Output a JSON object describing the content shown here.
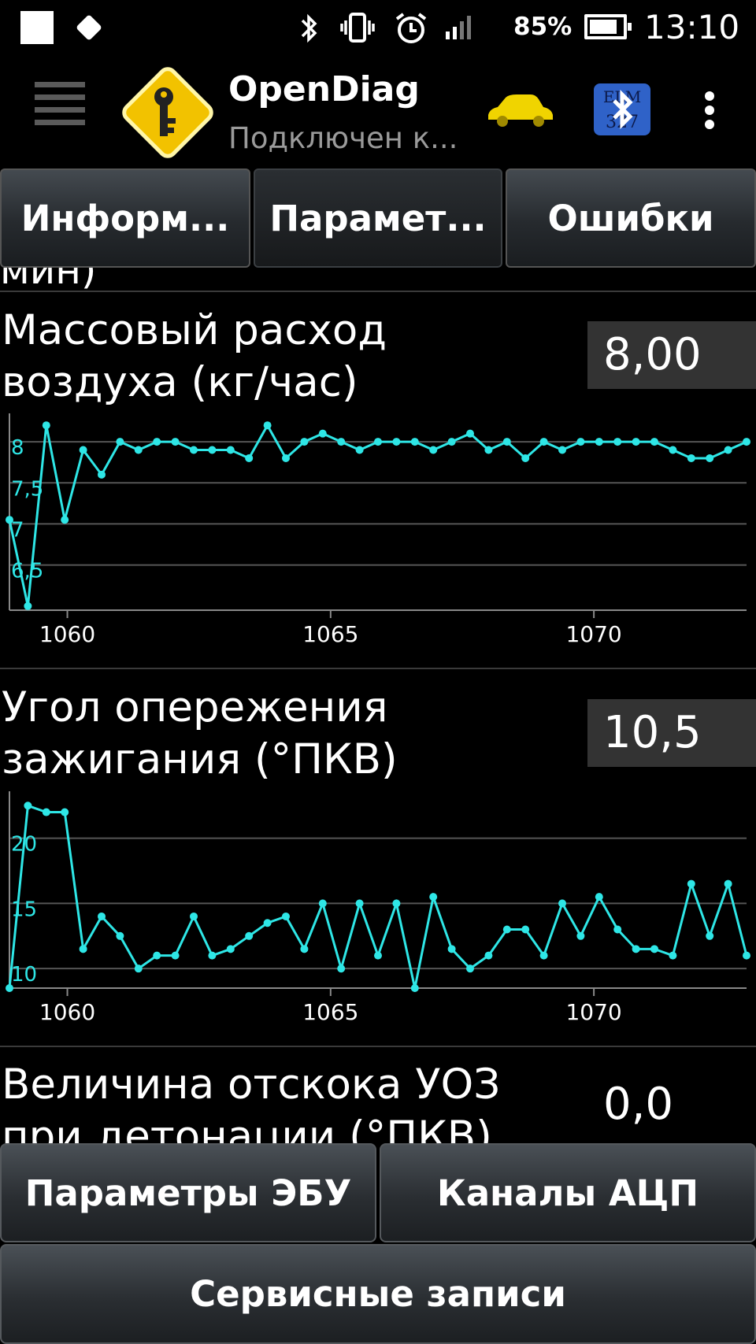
{
  "status_bar": {
    "battery_percent": "85%",
    "time": "13:10",
    "icons": [
      "notification-square-icon",
      "notification-diamond-icon",
      "bluetooth-icon",
      "vibrate-icon",
      "alarm-icon",
      "signal-icon",
      "battery-icon"
    ]
  },
  "app_bar": {
    "title": "OpenDiag",
    "subtitle": "Подключен к...",
    "icons": [
      "menu-icon",
      "opendiag-logo-icon",
      "car-icon",
      "bluetooth-elm327-icon",
      "overflow-menu-icon"
    ]
  },
  "tabs": [
    {
      "label": "Информ...",
      "active": false
    },
    {
      "label": "Парамет...",
      "active": true
    },
    {
      "label": "Ошибки",
      "active": false
    }
  ],
  "content": {
    "cut_text": "мин)",
    "params": [
      {
        "name_line1": "Массовый расход",
        "name_line2": "воздуха (кг/час)",
        "value": "8,00"
      },
      {
        "name_line1": "Угол опережения",
        "name_line2": "зажигания (°ПКВ)",
        "value": "10,5"
      },
      {
        "name_line1": "Величина отскока УОЗ",
        "name_line2": "при детонации (°ПКВ)",
        "value": "0,0"
      }
    ]
  },
  "chart_data": [
    {
      "type": "line",
      "color": "#2ee6e6",
      "x_ticks": [
        "1060",
        "1065",
        "1070"
      ],
      "y_ticks": [
        "6,5",
        "7",
        "7,5",
        "8"
      ],
      "x": [
        1058.9,
        1059.25,
        1059.6,
        1059.95,
        1060.3,
        1060.65,
        1061.0,
        1061.35,
        1061.7,
        1062.05,
        1062.4,
        1062.75,
        1063.1,
        1063.45,
        1063.8,
        1064.15,
        1064.5,
        1064.85,
        1065.2,
        1065.55,
        1065.9,
        1066.25,
        1066.6,
        1066.95,
        1067.3,
        1067.65,
        1068.0,
        1068.35,
        1068.7,
        1069.05,
        1069.4,
        1069.75,
        1070.1,
        1070.45,
        1070.8,
        1071.15,
        1071.5,
        1071.85,
        1072.2,
        1072.55,
        1072.9
      ],
      "values": [
        7.05,
        6.0,
        8.2,
        7.05,
        7.9,
        7.6,
        8.0,
        7.9,
        8.0,
        8.0,
        7.9,
        7.9,
        7.9,
        7.8,
        8.2,
        7.8,
        8.0,
        8.1,
        8.0,
        7.9,
        8.0,
        8.0,
        8.0,
        7.9,
        8.0,
        8.1,
        7.9,
        8.0,
        7.8,
        8.0,
        7.9,
        8.0,
        8.0,
        8.0,
        8.0,
        8.0,
        7.9,
        7.8,
        7.8,
        7.9,
        8.0
      ],
      "ylim": [
        5.95,
        8.25
      ],
      "xlim": [
        1058.9,
        1072.9
      ],
      "grid": true
    },
    {
      "type": "line",
      "color": "#2ee6e6",
      "x_ticks": [
        "1060",
        "1065",
        "1070"
      ],
      "y_ticks": [
        "10",
        "15",
        "20"
      ],
      "x": [
        1058.9,
        1059.25,
        1059.6,
        1059.95,
        1060.3,
        1060.65,
        1061.0,
        1061.35,
        1061.7,
        1062.05,
        1062.4,
        1062.75,
        1063.1,
        1063.45,
        1063.8,
        1064.15,
        1064.5,
        1064.85,
        1065.2,
        1065.55,
        1065.9,
        1066.25,
        1066.6,
        1066.95,
        1067.3,
        1067.65,
        1068.0,
        1068.35,
        1068.7,
        1069.05,
        1069.4,
        1069.75,
        1070.1,
        1070.45,
        1070.8,
        1071.15,
        1071.5,
        1071.85,
        1072.2,
        1072.55,
        1072.9
      ],
      "values": [
        8.5,
        22.5,
        22.0,
        22.0,
        11.5,
        14.0,
        12.5,
        10.0,
        11.0,
        11.0,
        14.0,
        11.0,
        11.5,
        12.5,
        13.5,
        14.0,
        11.5,
        15.0,
        10.0,
        15.0,
        11.0,
        15.0,
        8.5,
        15.5,
        11.5,
        10.0,
        11.0,
        13.0,
        13.0,
        11.0,
        15.0,
        12.5,
        15.5,
        13.0,
        11.5,
        11.5,
        11.0,
        16.5,
        12.5,
        16.5,
        11.0
      ],
      "ylim": [
        8.5,
        23.0
      ],
      "xlim": [
        1058.9,
        1072.9
      ],
      "grid": true
    }
  ],
  "bottom_buttons": {
    "ecu_params": "Параметры ЭБУ",
    "adc_channels": "Каналы АЦП",
    "service_records": "Сервисные записи"
  }
}
